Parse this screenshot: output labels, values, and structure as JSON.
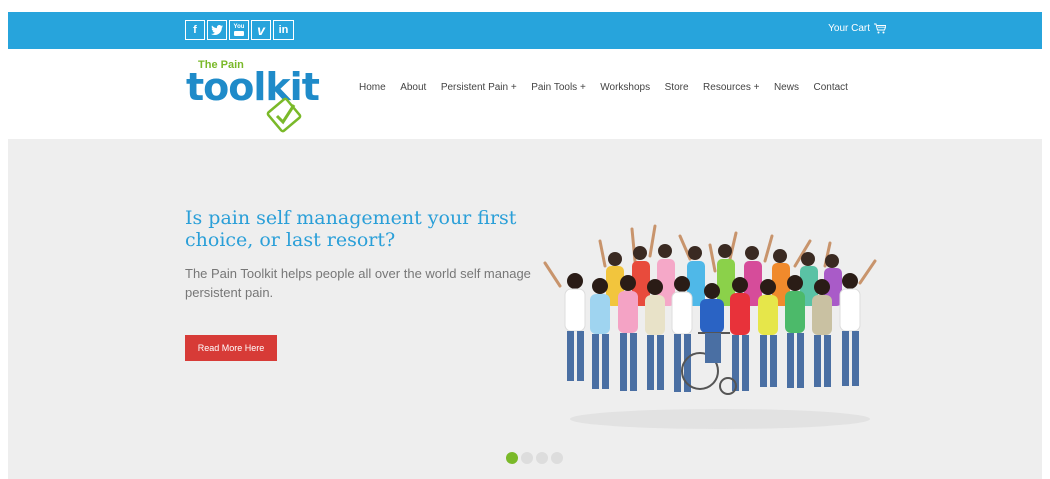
{
  "topbar": {
    "social": [
      {
        "name": "facebook",
        "glyph": "f"
      },
      {
        "name": "twitter",
        "glyph": "t"
      },
      {
        "name": "youtube",
        "glyph": "You"
      },
      {
        "name": "vimeo",
        "glyph": "v"
      },
      {
        "name": "linkedin",
        "glyph": "in"
      }
    ],
    "cart_label": "Your Cart"
  },
  "logo": {
    "small_text": "The Pain",
    "big_text": "toolkit"
  },
  "nav": {
    "items": [
      "Home",
      "About",
      "Persistent Pain +",
      "Pain Tools +",
      "Workshops",
      "Store",
      "Resources +",
      "News",
      "Contact"
    ]
  },
  "hero": {
    "headline": "Is pain self management your first choice, or last resort?",
    "subtext": "The Pain Toolkit helps people all over the world self manage persistent pain.",
    "cta_label": "Read More Here"
  },
  "slider": {
    "slide_count": 4,
    "active_index": 0
  },
  "colors": {
    "brand_blue": "#27a4dc",
    "brand_green": "#7ab929",
    "cta_red": "#d73b37",
    "hero_bg": "#eeeeee"
  }
}
